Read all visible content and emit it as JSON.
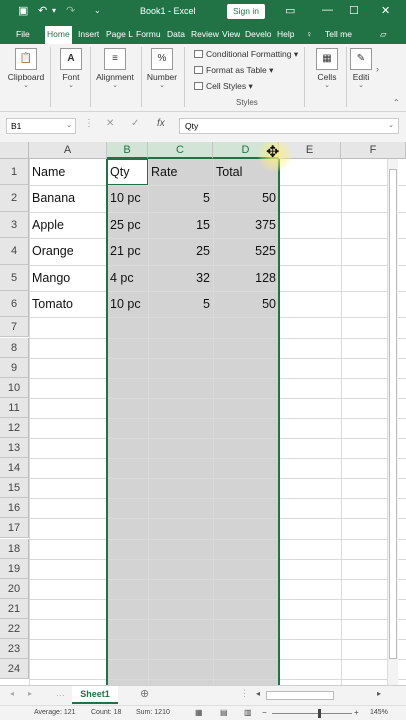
{
  "app": {
    "title": "Book1  -  Excel",
    "signin": "Sign in",
    "tellme": "Tell me"
  },
  "tabs": [
    "File",
    "Home",
    "Insert",
    "Page L",
    "Formu",
    "Data",
    "Review",
    "View",
    "Develo",
    "Help"
  ],
  "ribbon": {
    "groups": [
      {
        "name": "clipboard",
        "label": "Clipboard",
        "icon": "clipboard-icon"
      },
      {
        "name": "font",
        "label": "Font",
        "icon": "font-icon"
      },
      {
        "name": "alignment",
        "label": "Alignment",
        "icon": "alignment-icon"
      },
      {
        "name": "number",
        "label": "Number",
        "icon": "percent-icon"
      },
      {
        "name": "cells",
        "label": "Cells",
        "icon": "cells-icon"
      },
      {
        "name": "editing",
        "label": "Editi",
        "icon": "editing-icon"
      }
    ],
    "styles": {
      "conditional": "Conditional Formatting",
      "format_table": "Format as Table",
      "cell_styles": "Cell Styles",
      "label": "Styles"
    }
  },
  "formula_bar": {
    "name_box": "B1",
    "content": "Qty",
    "fx": "fx"
  },
  "grid": {
    "columns": [
      "A",
      "B",
      "C",
      "D",
      "E",
      "F"
    ],
    "selected_columns": [
      "B",
      "C",
      "D"
    ],
    "rows": [
      {
        "n": "1",
        "cells": [
          "Name",
          "Qty",
          "Rate",
          "Total"
        ]
      },
      {
        "n": "2",
        "cells": [
          "Banana",
          "10 pc",
          "5",
          "50"
        ]
      },
      {
        "n": "3",
        "cells": [
          "Apple",
          "25 pc",
          "15",
          "375"
        ]
      },
      {
        "n": "4",
        "cells": [
          "Orange",
          "21 pc",
          "25",
          "525"
        ]
      },
      {
        "n": "5",
        "cells": [
          "Mango",
          "4 pc",
          "32",
          "128"
        ]
      },
      {
        "n": "6",
        "cells": [
          "Tomato",
          "10 pc",
          "5",
          "50"
        ]
      },
      {
        "n": "7",
        "cells": [
          "",
          "",
          "",
          ""
        ]
      },
      {
        "n": "8",
        "cells": [
          "",
          "",
          "",
          ""
        ]
      },
      {
        "n": "9",
        "cells": [
          "",
          "",
          "",
          ""
        ]
      },
      {
        "n": "10",
        "cells": [
          "",
          "",
          "",
          ""
        ]
      },
      {
        "n": "11",
        "cells": [
          "",
          "",
          "",
          ""
        ]
      },
      {
        "n": "12",
        "cells": [
          "",
          "",
          "",
          ""
        ]
      },
      {
        "n": "13",
        "cells": [
          "",
          "",
          "",
          ""
        ]
      },
      {
        "n": "14",
        "cells": [
          "",
          "",
          "",
          ""
        ]
      },
      {
        "n": "15",
        "cells": [
          "",
          "",
          "",
          ""
        ]
      },
      {
        "n": "16",
        "cells": [
          "",
          "",
          "",
          ""
        ]
      },
      {
        "n": "17",
        "cells": [
          "",
          "",
          "",
          ""
        ]
      },
      {
        "n": "18",
        "cells": [
          "",
          "",
          "",
          ""
        ]
      },
      {
        "n": "19",
        "cells": [
          "",
          "",
          "",
          ""
        ]
      },
      {
        "n": "20",
        "cells": [
          "",
          "",
          "",
          ""
        ]
      },
      {
        "n": "21",
        "cells": [
          "",
          "",
          "",
          ""
        ]
      },
      {
        "n": "22",
        "cells": [
          "",
          "",
          "",
          ""
        ]
      },
      {
        "n": "23",
        "cells": [
          "",
          "",
          "",
          ""
        ]
      },
      {
        "n": "24",
        "cells": [
          "",
          "",
          "",
          ""
        ]
      }
    ]
  },
  "sheets": [
    "Sheet1"
  ],
  "status": {
    "average": "Average: 121",
    "count": "Count: 18",
    "sum": "Sum: 1210",
    "zoom": "145%"
  },
  "colors": {
    "accent": "#217346",
    "selection": "#d3d3d3"
  }
}
